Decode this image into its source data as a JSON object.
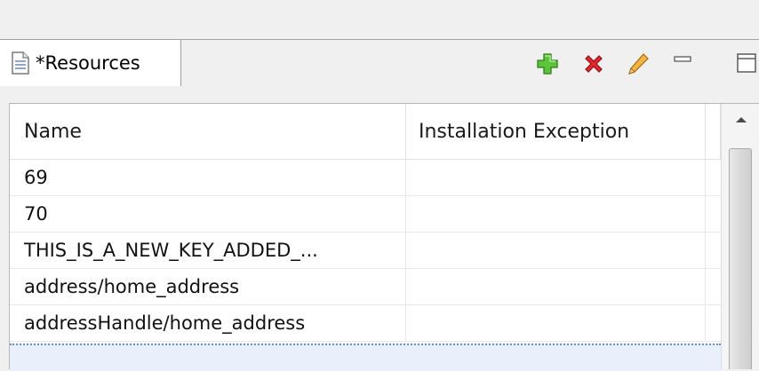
{
  "view": {
    "tab_label": "*Resources",
    "tab_icon": "document-icon"
  },
  "toolbar": {
    "items": [
      "add-icon",
      "delete-icon",
      "edit-icon",
      "minimize-icon",
      "maximize-icon"
    ],
    "colors": {
      "add": "#4caf2e",
      "delete": "#d6202a",
      "edit": "#e0a030"
    }
  },
  "table": {
    "columns": [
      "Name",
      "Installation Exception"
    ],
    "rows": [
      {
        "name": "69",
        "exception": ""
      },
      {
        "name": "70",
        "exception": ""
      },
      {
        "name": "THIS_IS_A_NEW_KEY_ADDED_...",
        "exception": ""
      },
      {
        "name": "address/home_address",
        "exception": ""
      },
      {
        "name": "addressHandle/home_address",
        "exception": ""
      }
    ]
  }
}
